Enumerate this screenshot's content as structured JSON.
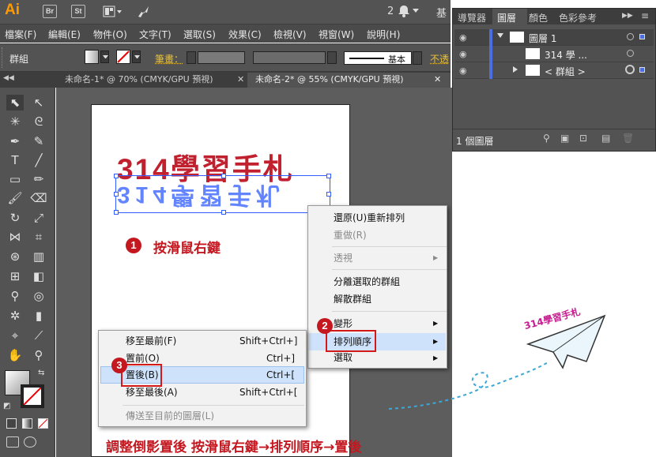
{
  "app": {
    "logo": "Ai",
    "br_label": "Br",
    "st_label": "St",
    "notif_count": "2",
    "ws_label": "基"
  },
  "menu": [
    "檔案(F)",
    "編輯(E)",
    "物件(O)",
    "文字(T)",
    "選取(S)",
    "效果(C)",
    "檢視(V)",
    "視窗(W)",
    "說明(H)"
  ],
  "control": {
    "selection": "群組",
    "stroke_label": "筆畫：",
    "stroke_style": "基本",
    "opacity_label": "不透"
  },
  "doc_tabs": [
    {
      "label": "未命名-1* @ 70% (CMYK/GPU 預視)",
      "close": "✕"
    },
    {
      "label": "未命名-2* @ 55% (CMYK/GPU 預視)",
      "close": "✕"
    }
  ],
  "panel": {
    "tabs": [
      "導覽器",
      "圖層",
      "顏色",
      "色彩參考"
    ],
    "status": "1 個圖層",
    "rows": [
      "圖層 1",
      "314 學 ...",
      "< 群組 >"
    ]
  },
  "artwork": {
    "title": "314學習手札",
    "reflection": "314學習手札"
  },
  "context_menu": [
    {
      "label": "還原(U)重新排列",
      "disabled": false,
      "arrow": false
    },
    {
      "label": "重做(R)",
      "disabled": true,
      "arrow": false
    },
    {
      "label": "透視",
      "disabled": true,
      "arrow": true
    },
    {
      "label": "分離選取的群組",
      "disabled": false,
      "arrow": false
    },
    {
      "label": "解散群組",
      "disabled": false,
      "arrow": false
    },
    {
      "label": "變形",
      "disabled": false,
      "arrow": true
    },
    {
      "label": "排列順序",
      "disabled": false,
      "arrow": true
    },
    {
      "label": "選取",
      "disabled": false,
      "arrow": true
    }
  ],
  "submenu": [
    {
      "label": "移至最前(F)",
      "shortcut": "Shift+Ctrl+]"
    },
    {
      "label": "置前(O)",
      "shortcut": "Ctrl+]"
    },
    {
      "label": "置後(B)",
      "shortcut": "Ctrl+["
    },
    {
      "label": "移至最後(A)",
      "shortcut": "Shift+Ctrl+["
    },
    {
      "label": "傳送至目前的圖層(L)",
      "shortcut": ""
    }
  ],
  "annotations": {
    "step1_num": "1",
    "step1": "按滑鼠右鍵",
    "step2_num": "2",
    "step3_num": "3",
    "bottom": "調整倒影置後 按滑鼠右鍵→排列順序→置後",
    "plane": "314學習手札"
  },
  "icons": {
    "arrow": "▶",
    "bell": "bell-icon"
  },
  "colors": {
    "accent_red": "#c4171f",
    "selection_blue": "#2f5bff",
    "title_red": "#c1202e",
    "highlight": "#cfe2fb"
  }
}
